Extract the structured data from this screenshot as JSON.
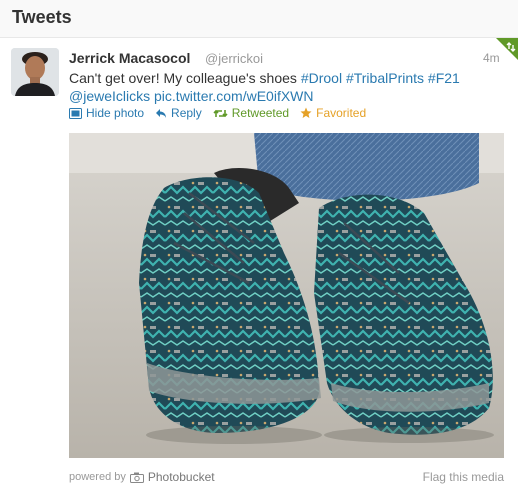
{
  "header": {
    "title": "Tweets"
  },
  "tweet": {
    "fullname": "Jerrick Macasocol",
    "username": "@jerrickoi",
    "time": "4m",
    "text_plain": "Can't get over! My colleague's shoes",
    "hashtags": [
      "#Drool",
      "#TribalPrints",
      "#F21"
    ],
    "mention": "@jeweIclicks",
    "link": "pic.twitter.com/wE0ifXWN",
    "actions": {
      "hide_photo": "Hide photo",
      "reply": "Reply",
      "retweeted": "Retweeted",
      "favorited": "Favorited"
    },
    "media": {
      "powered_by": "powered by",
      "provider": "Photobucket",
      "flag": "Flag this media"
    }
  },
  "colors": {
    "link": "#2a7ab0",
    "retweeted": "#609928",
    "favorited": "#e5a127",
    "header_bg": "#f9f9f9"
  },
  "icons": [
    "photo-icon",
    "reply-icon",
    "retweet-icon",
    "star-icon",
    "camera-icon",
    "retweet-corner-badge"
  ]
}
